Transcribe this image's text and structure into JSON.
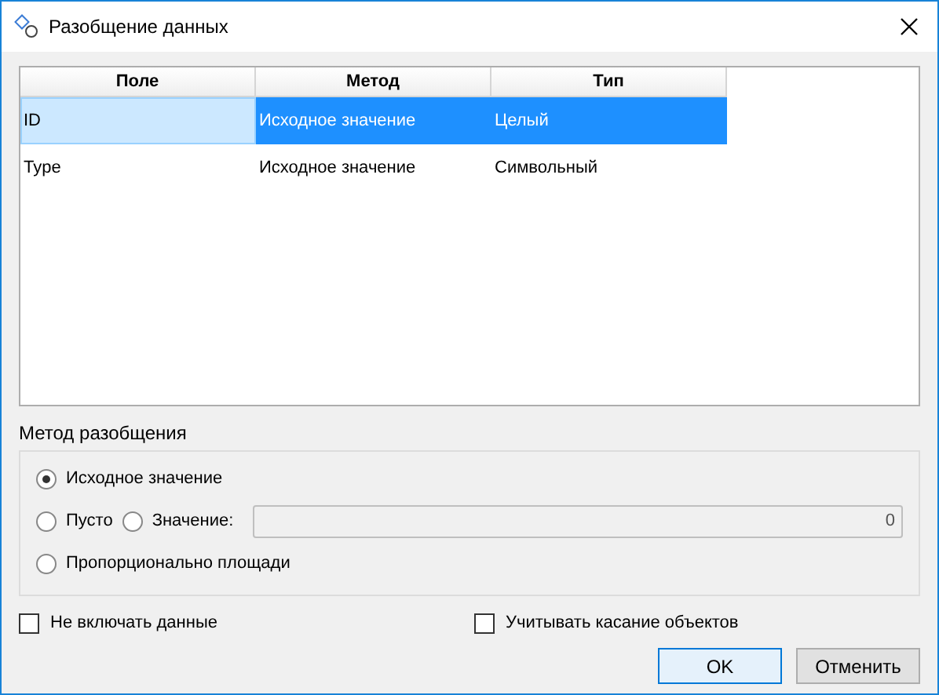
{
  "window": {
    "title": "Разобщение данных"
  },
  "table": {
    "columns": [
      "Поле",
      "Метод",
      "Тип"
    ],
    "rows": [
      {
        "cells": [
          "ID",
          "Исходное значение",
          "Целый"
        ],
        "selected": true
      },
      {
        "cells": [
          "Type",
          "Исходное значение",
          "Символьный"
        ],
        "selected": false
      }
    ]
  },
  "method_group": {
    "title": "Метод разобщения",
    "option_rows": [
      {
        "options": [
          {
            "label": "Исходное значение",
            "selected": true
          }
        ]
      },
      {
        "options": [
          {
            "label": "Пусто",
            "selected": false
          },
          {
            "label": "Значение:",
            "selected": false
          }
        ],
        "field": {
          "value": "0",
          "disabled": true
        }
      },
      {
        "options": [
          {
            "label": "Пропорционально площади",
            "selected": false
          }
        ]
      }
    ]
  },
  "checkboxes": [
    {
      "label": "Не включать данные",
      "checked": false
    },
    {
      "label": "Учитывать касание объектов",
      "checked": false
    }
  ],
  "buttons": [
    {
      "label": "OK",
      "default": true
    },
    {
      "label": "Отменить",
      "default": false
    }
  ]
}
